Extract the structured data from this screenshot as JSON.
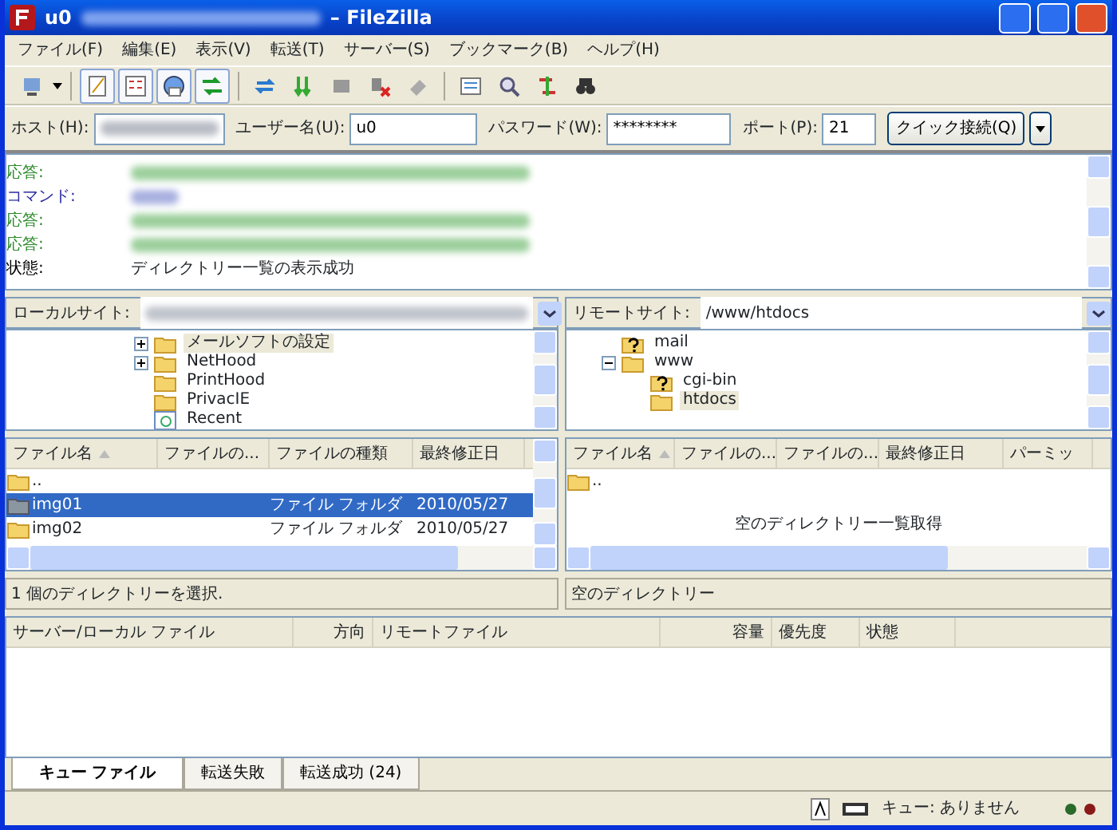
{
  "window": {
    "title_start": "u0",
    "title_end": "– FileZilla"
  },
  "menu": [
    "ファイル(F)",
    "編集(E)",
    "表示(V)",
    "転送(T)",
    "サーバー(S)",
    "ブックマーク(B)",
    "ヘルプ(H)"
  ],
  "toolbar": [
    {
      "on": false
    },
    {
      "on": true
    },
    {
      "on": true
    },
    {
      "on": true
    },
    {
      "on": true
    },
    {
      "on": false
    },
    {
      "on": false
    },
    {
      "on": false
    },
    {
      "on": false
    },
    {
      "on": false
    },
    {
      "on": false
    },
    {
      "on": false
    },
    {
      "on": false
    },
    {
      "on": false
    }
  ],
  "quickconnect": {
    "host_label": "ホスト(H):",
    "user_label": "ユーザー名(U):",
    "user_value": "u0",
    "password_label": "パスワード(W):",
    "password_value": "********",
    "port_label": "ポート(P):",
    "port_value": "21",
    "button": "クイック接続(Q)"
  },
  "log": [
    {
      "kind": "response",
      "label": "応答:"
    },
    {
      "kind": "command",
      "label": "コマンド:"
    },
    {
      "kind": "response",
      "label": "応答:"
    },
    {
      "kind": "response",
      "label": "応答:"
    },
    {
      "kind": "status",
      "label": "状態:",
      "message": "ディレクトリー一覧の表示成功"
    }
  ],
  "local": {
    "site_label": "ローカルサイト:",
    "tree": [
      {
        "label": "メールソフトの設定",
        "kind": "folder",
        "expandable": true,
        "selected": true
      },
      {
        "label": "NetHood",
        "kind": "folder",
        "expandable": true,
        "selected": false
      },
      {
        "label": "PrintHood",
        "kind": "folder",
        "expandable": false,
        "selected": false
      },
      {
        "label": "PrivacIE",
        "kind": "folder",
        "expandable": false,
        "selected": false
      },
      {
        "label": "Recent",
        "kind": "special",
        "expandable": false,
        "selected": false
      }
    ],
    "columns": [
      "ファイル名",
      "ファイルの...",
      "ファイルの種類",
      "最終修正日"
    ],
    "rows": [
      {
        "name": "..",
        "type": "",
        "date": "",
        "selected": false
      },
      {
        "name": "img01",
        "type": "ファイル フォルダ",
        "date": "2010/05/27",
        "selected": true
      },
      {
        "name": "img02",
        "type": "ファイル フォルダ",
        "date": "2010/05/27",
        "selected": false
      }
    ],
    "status": "1 個のディレクトリーを選択."
  },
  "remote": {
    "site_label": "リモートサイト:",
    "path": "/www/htdocs",
    "tree": [
      {
        "label": "mail",
        "kind": "unknown",
        "selected": false
      },
      {
        "label": "www",
        "kind": "folder",
        "expanded": true,
        "selected": false,
        "children": [
          {
            "label": "cgi-bin",
            "kind": "unknown",
            "selected": false
          },
          {
            "label": "htdocs",
            "kind": "folder",
            "selected": true
          }
        ]
      }
    ],
    "columns": [
      "ファイル名",
      "ファイルの...",
      "ファイルの...",
      "最終修正日",
      "パーミッ"
    ],
    "rows": [
      {
        "name": ".."
      }
    ],
    "empty_message": "空のディレクトリー一覧取得",
    "status": "空のディレクトリー"
  },
  "queue": {
    "columns": [
      "サーバー/ローカル ファイル",
      "方向",
      "リモートファイル",
      "容量",
      "優先度",
      "状態"
    ],
    "tabs": [
      {
        "label": "キュー ファイル",
        "selected": true
      },
      {
        "label": "転送失敗",
        "selected": false
      },
      {
        "label": "転送成功 (24)",
        "selected": false
      }
    ]
  },
  "status_bar": {
    "queue": "キュー: ありません"
  }
}
